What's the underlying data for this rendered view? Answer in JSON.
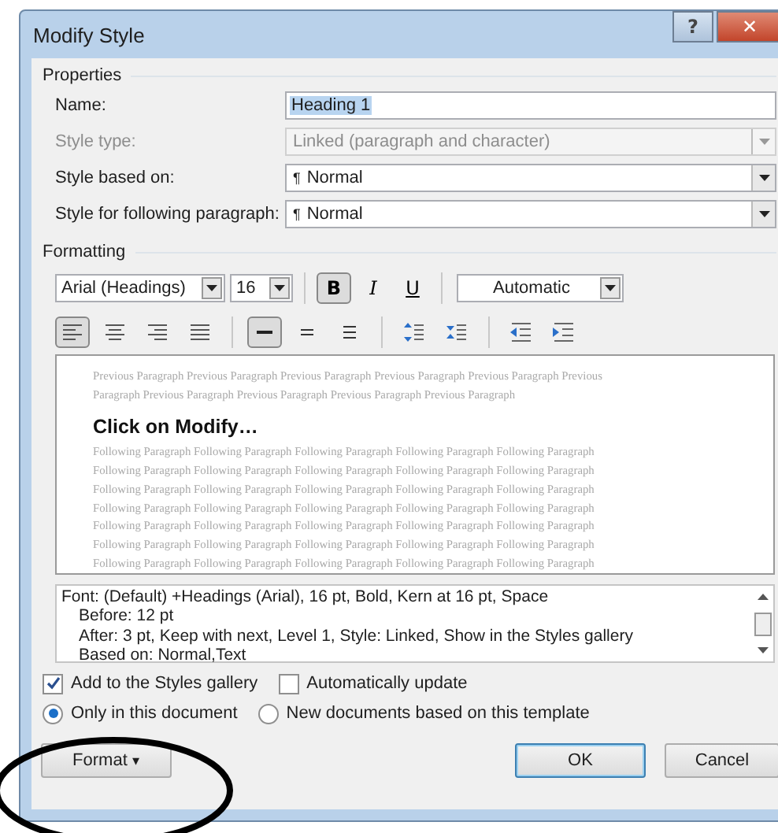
{
  "window": {
    "title": "Modify Style",
    "help_button": "?",
    "close_button": "✕"
  },
  "properties": {
    "title": "Properties",
    "fields": [
      {
        "label": "Name:",
        "kind": "text",
        "value": "Heading 1",
        "disabled": false
      },
      {
        "label": "Style type:",
        "kind": "dropdown",
        "value": "Linked (paragraph and character)",
        "disabled": true
      },
      {
        "label": "Style based on:",
        "kind": "dropdown",
        "marker": "¶",
        "value": "Normal",
        "disabled": false
      },
      {
        "label": "Style for following paragraph:",
        "kind": "dropdown",
        "marker": "¶",
        "value": "Normal",
        "disabled": false
      }
    ]
  },
  "formatting": {
    "title": "Formatting",
    "font": "Arial (Headings)",
    "size": "16",
    "styles": [
      {
        "label": "B",
        "kind": "bold",
        "selected": true
      },
      {
        "label": "I",
        "kind": "italic",
        "selected": false
      },
      {
        "label": "U",
        "kind": "underline",
        "selected": false
      }
    ],
    "font_color_choice": "Automatic",
    "paragraph_tools": [
      {
        "kind": "align-left",
        "selected": true
      },
      {
        "kind": "align-center",
        "selected": false
      },
      {
        "kind": "align-right",
        "selected": false
      },
      {
        "kind": "justify",
        "selected": false
      },
      {
        "kind": "sep"
      },
      {
        "kind": "single-spacing",
        "selected": true
      },
      {
        "kind": "onehalf-spacing",
        "selected": false
      },
      {
        "kind": "double-spacing",
        "selected": false
      },
      {
        "kind": "sep"
      },
      {
        "kind": "spacing-increase",
        "selected": false
      },
      {
        "kind": "spacing-decrease",
        "selected": false
      },
      {
        "kind": "sep"
      },
      {
        "kind": "indent-decrease",
        "selected": false
      },
      {
        "kind": "indent-increase",
        "selected": false
      }
    ]
  },
  "preview": {
    "previous_lines": [
      "Previous Paragraph Previous Paragraph Previous Paragraph Previous Paragraph Previous Paragraph Previous",
      "Paragraph Previous Paragraph Previous Paragraph Previous Paragraph Previous Paragraph"
    ],
    "sample": "Click on Modify…",
    "following_lines": [
      "Following Paragraph Following Paragraph Following Paragraph Following Paragraph Following Paragraph",
      "Following Paragraph Following Paragraph Following Paragraph Following Paragraph Following Paragraph",
      "Following Paragraph Following Paragraph Following Paragraph Following Paragraph Following Paragraph",
      "Following Paragraph Following Paragraph Following Paragraph Following Paragraph Following Paragraph",
      "Following Paragraph Following Paragraph Following Paragraph Following Paragraph Following Paragraph",
      "Following Paragraph Following Paragraph Following Paragraph Following Paragraph Following Paragraph",
      "Following Paragraph Following Paragraph Following Paragraph Following Paragraph Following Paragraph"
    ]
  },
  "description": [
    "Font: (Default) +Headings (Arial), 16 pt, Bold, Kern at 16 pt, Space",
    "Before:  12 pt",
    "After:  3 pt, Keep with next, Level 1, Style: Linked, Show in the Styles gallery",
    "Based on: Normal,Text"
  ],
  "checkboxes": [
    {
      "label": "Add to the Styles gallery",
      "checked": true
    },
    {
      "label": "Automatically update",
      "checked": false
    }
  ],
  "radios": [
    {
      "label": "Only in this document",
      "selected": true
    },
    {
      "label": "New documents based on this template",
      "selected": false
    }
  ],
  "buttons": [
    {
      "label": "Format",
      "kind": "menu",
      "caret": "▾",
      "default": false
    },
    {
      "label": "OK",
      "kind": "ok",
      "default": true
    },
    {
      "label": "Cancel",
      "kind": "cancel",
      "default": false
    }
  ]
}
